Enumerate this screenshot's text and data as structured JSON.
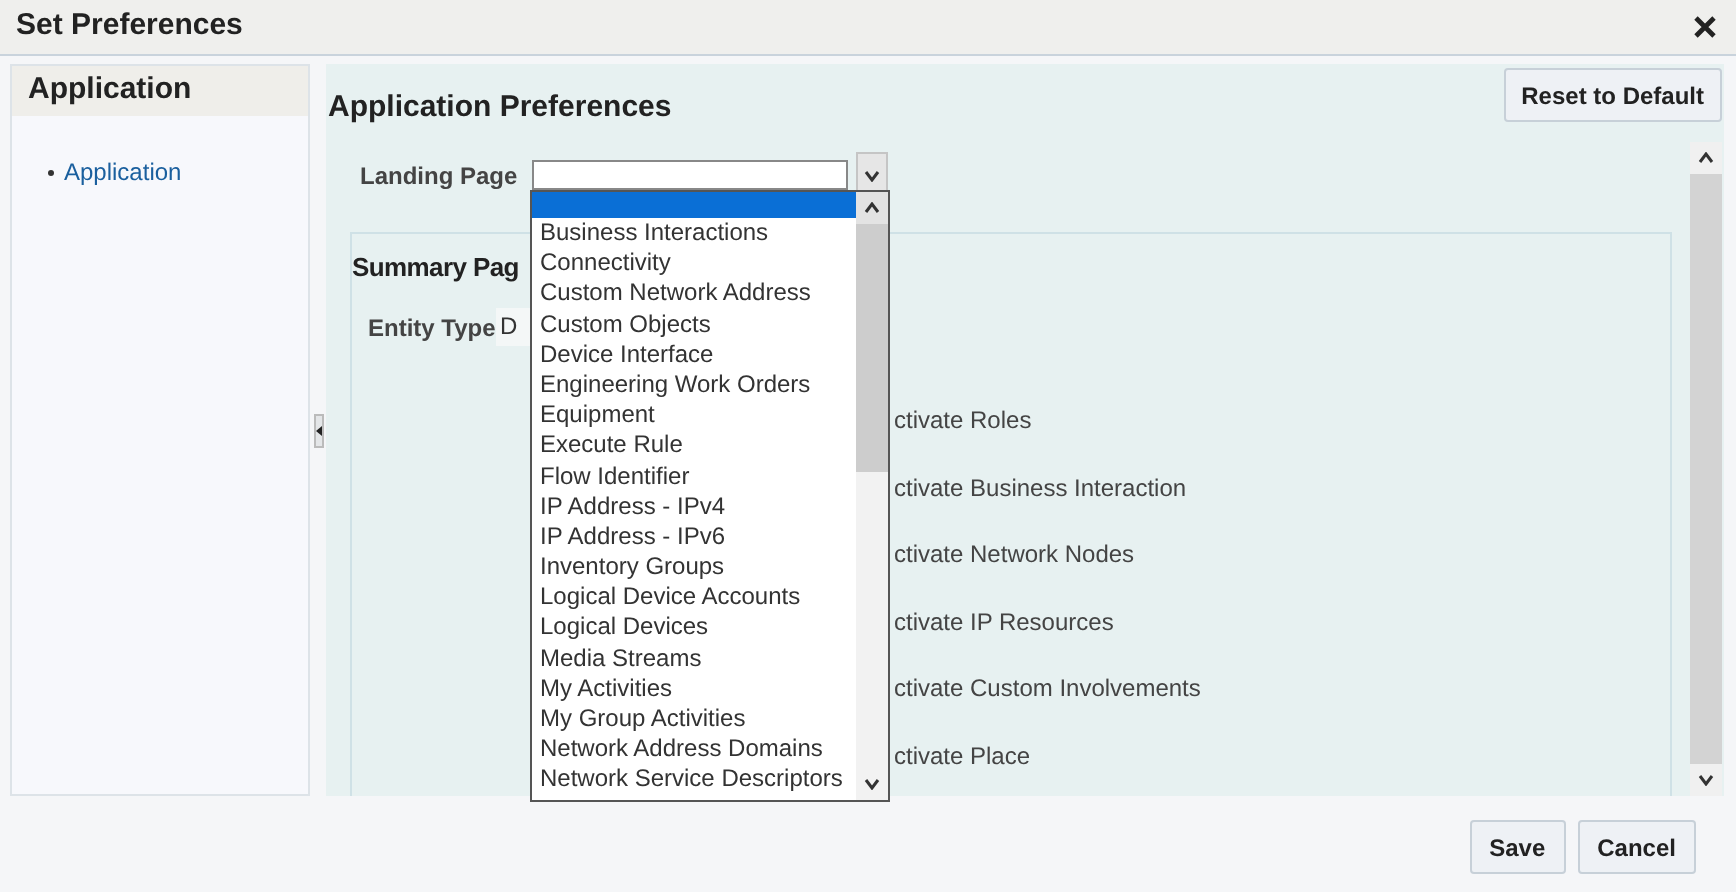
{
  "dialog": {
    "title": "Set Preferences"
  },
  "sidebar": {
    "header": "Application",
    "items": [
      "Application"
    ]
  },
  "main": {
    "heading": "Application Preferences",
    "reset_button": "Reset to Default",
    "landing_page": {
      "label": "Landing Page"
    }
  },
  "dropdown": {
    "blank_option_selected": true,
    "options": [
      {
        "label": "Business Interactions",
        "selected": false
      },
      {
        "label": "Connectivity",
        "selected": false
      },
      {
        "label": "Custom Network Address",
        "selected": false
      },
      {
        "label": "Custom Objects",
        "selected": false
      },
      {
        "label": "Device Interface",
        "selected": false
      },
      {
        "label": "Engineering Work Orders",
        "selected": false
      },
      {
        "label": "Equipment",
        "selected": false
      },
      {
        "label": "Execute Rule",
        "selected": false
      },
      {
        "label": "Flow Identifier",
        "selected": false
      },
      {
        "label": "IP Address - IPv4",
        "selected": false
      },
      {
        "label": "IP Address - IPv6",
        "selected": false
      },
      {
        "label": "Inventory Groups",
        "selected": false
      },
      {
        "label": "Logical Device Accounts",
        "selected": false
      },
      {
        "label": "Logical Devices",
        "selected": false
      },
      {
        "label": "Media Streams",
        "selected": false
      },
      {
        "label": "My Activities",
        "selected": false
      },
      {
        "label": "My Group Activities",
        "selected": false
      },
      {
        "label": "Network Address Domains",
        "selected": false
      },
      {
        "label": "Network Service Descriptors",
        "selected": false
      }
    ]
  },
  "summary": {
    "heading": "Summary Pag",
    "entity_type": {
      "label": "Entity Type",
      "value": "D"
    },
    "actions": [
      "ctivate Roles",
      "ctivate Business Interaction",
      "ctivate Network Nodes",
      "ctivate IP Resources",
      "ctivate Custom Involvements",
      "ctivate Place"
    ]
  },
  "buttons": [
    "Save",
    "Cancel"
  ]
}
